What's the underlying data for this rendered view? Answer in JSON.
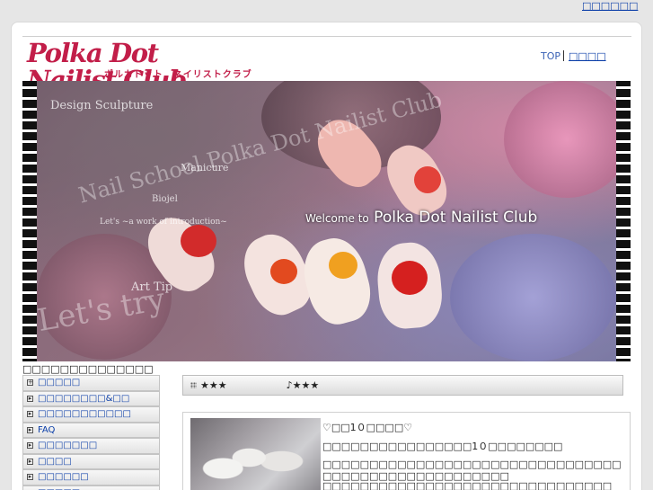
{
  "top_link": "□□□□□□",
  "logo": {
    "en": "Polka Dot Nailist Club",
    "jp": "ポルカドット　ネイリストクラブ"
  },
  "header_nav": {
    "top": "TOP",
    "second": "□□□□"
  },
  "hero": {
    "texts": {
      "design": "Design Sculpture",
      "school": "Nail School Polka Dot Nailist Club",
      "manicure": "Manicure",
      "biojel": "Biojel",
      "works": "Let's ~a work of introduction~",
      "art": "Art Tip",
      "lets": "Let's try"
    },
    "welcome_to": "Welcome to",
    "welcome_name": "Polka Dot Nailist Club"
  },
  "sidebar": {
    "title": "□□□□□□□□□□□□□□",
    "items": [
      {
        "label": "□□□□□",
        "icon": "plus-icon"
      },
      {
        "label": "□□□□□□□□&□□",
        "icon": "boxed-arrow-icon"
      },
      {
        "label": "□□□□□□□□□□□",
        "icon": "boxed-arrow-icon"
      },
      {
        "label": "FAQ",
        "icon": "boxed-arrow-icon"
      },
      {
        "label": "□□□□□□□",
        "icon": "boxed-arrow-icon"
      },
      {
        "label": "□□□□",
        "icon": "boxed-arrow-icon"
      },
      {
        "label": "□□□□□□",
        "icon": "boxed-arrow-icon"
      },
      {
        "label": "□□□□□",
        "icon": "boxed-arrow-icon"
      }
    ]
  },
  "news_bar": {
    "left": "★★★",
    "right": "♪★★★"
  },
  "article": {
    "title": "♡□□1０□□□□♡",
    "line1": "□□□□□□□□□□□□□□□□1０□□□□□□□□",
    "line2": "□□□□□□□□□□□□□□□□□□□□□□□□□□□□□□□□□□□□□□□□□□□□□□□□□□□□",
    "line3": "□□□□□□□□□□□□□□□□□□□□□□□□□□□□□□□"
  }
}
